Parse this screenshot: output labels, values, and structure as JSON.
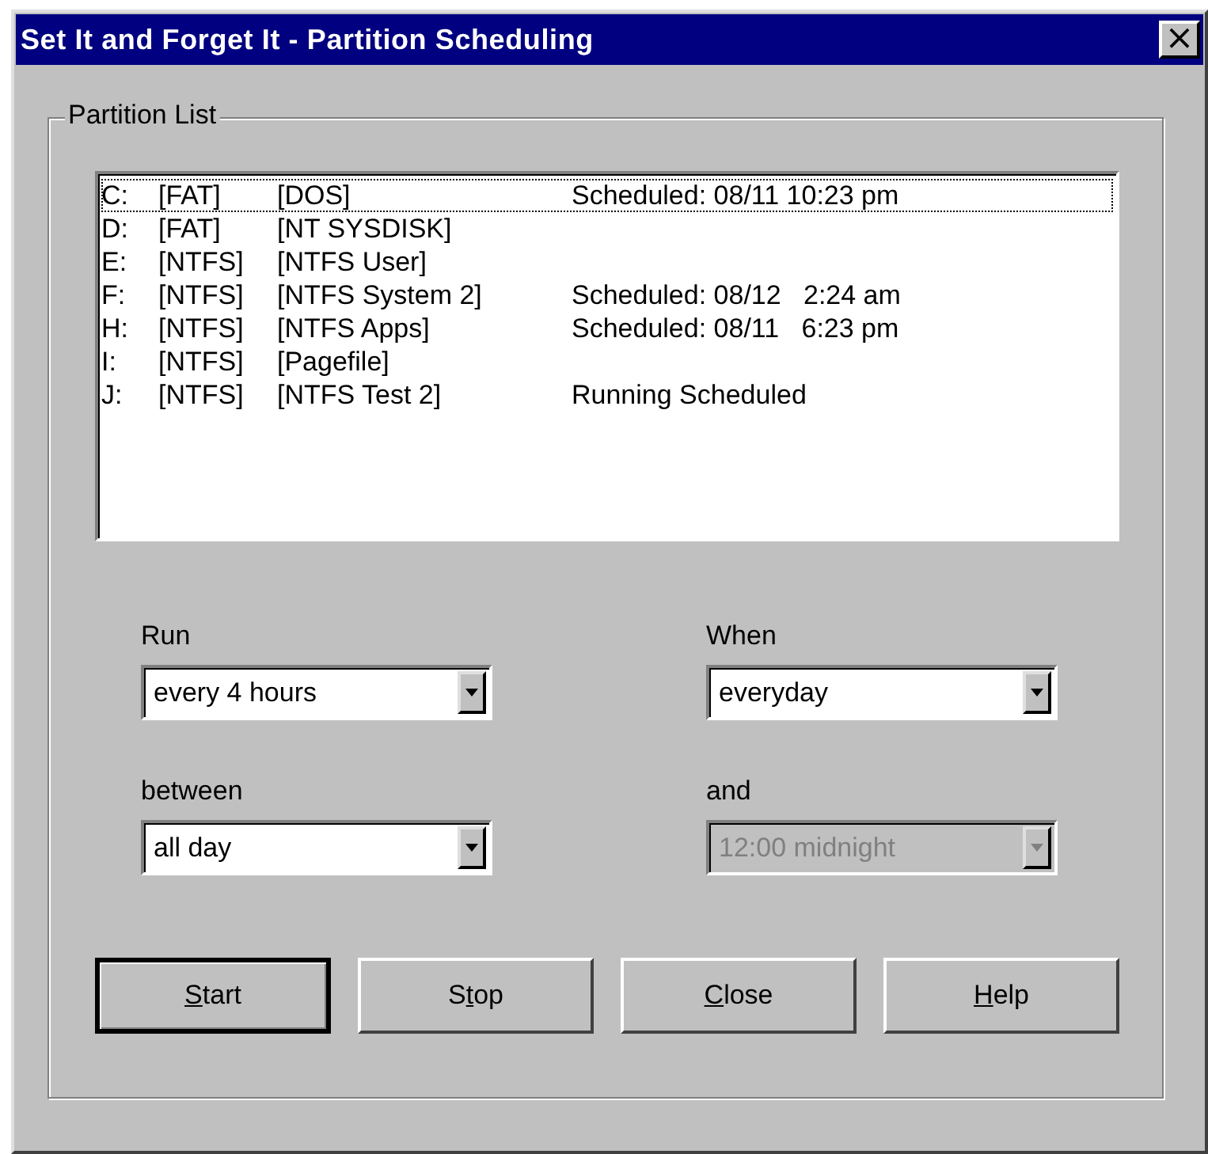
{
  "window": {
    "title": "Set It and Forget It - Partition Scheduling",
    "close": "×"
  },
  "partition_list": {
    "title": "Partition List",
    "rows": [
      {
        "drive": "C:",
        "fs": "[FAT]",
        "name": "[DOS]",
        "status": "Scheduled: 08/11 10:23 pm",
        "selected": true
      },
      {
        "drive": "D:",
        "fs": "[FAT]",
        "name": "[NT SYSDISK]",
        "selected": false
      },
      {
        "drive": "E:",
        "fs": "[NTFS]",
        "name": "[NTFS User]",
        "selected": false
      },
      {
        "drive": "F:",
        "fs": "[NTFS]",
        "name": "[NTFS System 2]",
        "status": "Scheduled: 08/12   2:24 am",
        "selected": false
      },
      {
        "drive": "H:",
        "fs": "[NTFS]",
        "name": "[NTFS Apps]",
        "status": "Scheduled: 08/11   6:23 pm",
        "selected": false
      },
      {
        "drive": "I:",
        "fs": "[NTFS]",
        "name": "[Pagefile]",
        "selected": false
      },
      {
        "drive": "J:",
        "fs": "[NTFS]",
        "name": "[NTFS Test 2]",
        "status": "Running Scheduled",
        "selected": false
      }
    ]
  },
  "fields": [
    {
      "label": "Run",
      "value": "every 4 hours",
      "disabled": false
    },
    {
      "label": "When",
      "value": "everyday",
      "disabled": false
    },
    {
      "label": "between",
      "value": "all day",
      "disabled": false
    },
    {
      "label": "and",
      "value": "12:00 midnight",
      "disabled": true
    }
  ],
  "buttons": [
    {
      "key": "S",
      "after": "tart",
      "default": true
    },
    {
      "before": "S",
      "key": "t",
      "after": "op",
      "default": false
    },
    {
      "key": "C",
      "after": "lose",
      "default": false
    },
    {
      "key": "H",
      "after": "elp",
      "default": false
    }
  ]
}
